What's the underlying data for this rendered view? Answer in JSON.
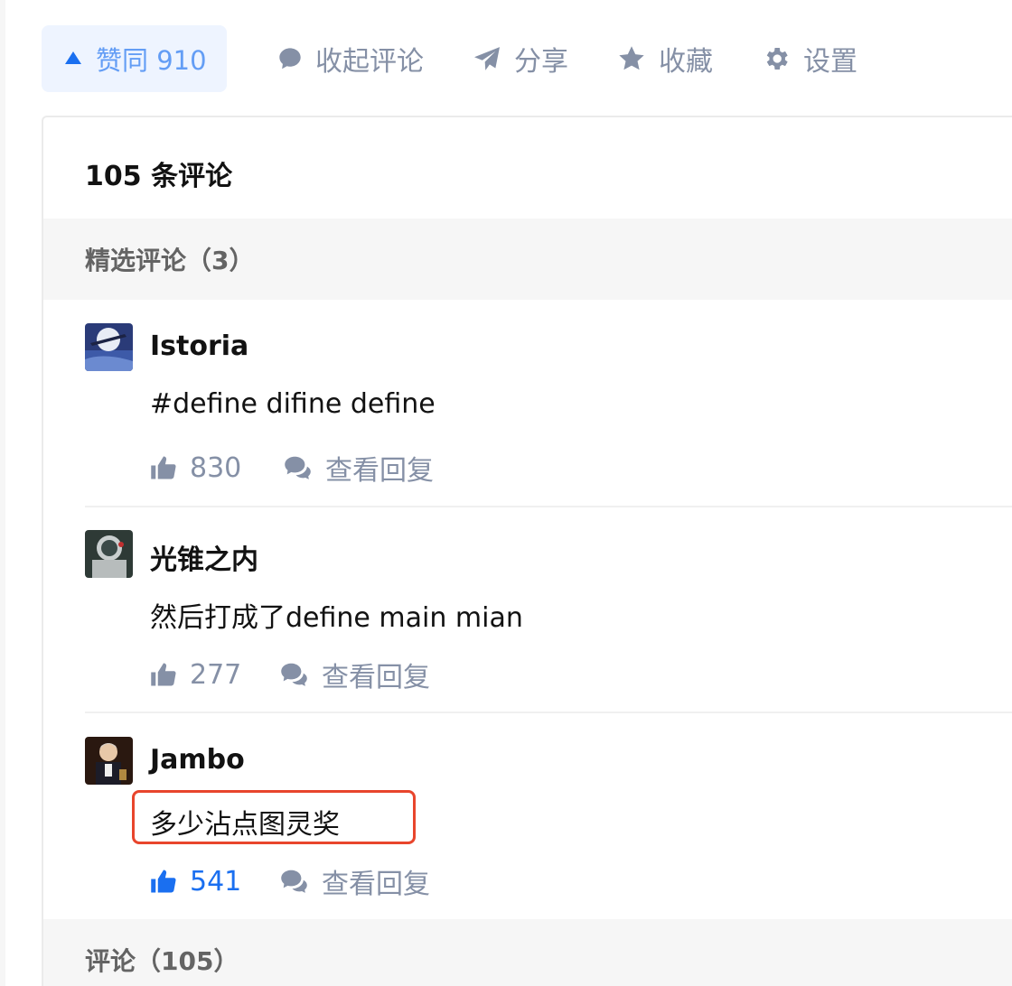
{
  "actions": {
    "vote_label": "赞同 910",
    "collapse_comments": "收起评论",
    "share": "分享",
    "favorite": "收藏",
    "settings": "设置"
  },
  "comments_panel": {
    "title": "105 条评论",
    "featured_header": "精选评论（3）",
    "all_header": "评论（105）",
    "featured": [
      {
        "author": "Istoria",
        "content": "#define difine define",
        "likes": "830",
        "view_replies": "查看回复",
        "liked": false
      },
      {
        "author": "光锥之内",
        "content": "然后打成了define main mian",
        "likes": "277",
        "view_replies": "查看回复",
        "liked": false
      },
      {
        "author": "Jambo",
        "content": "多少沾点图灵奖",
        "likes": "541",
        "view_replies": "查看回复",
        "liked": true
      }
    ]
  },
  "colors": {
    "accent": "#1a6ff0",
    "muted": "#8590a6",
    "highlight_border": "#e8452c"
  }
}
